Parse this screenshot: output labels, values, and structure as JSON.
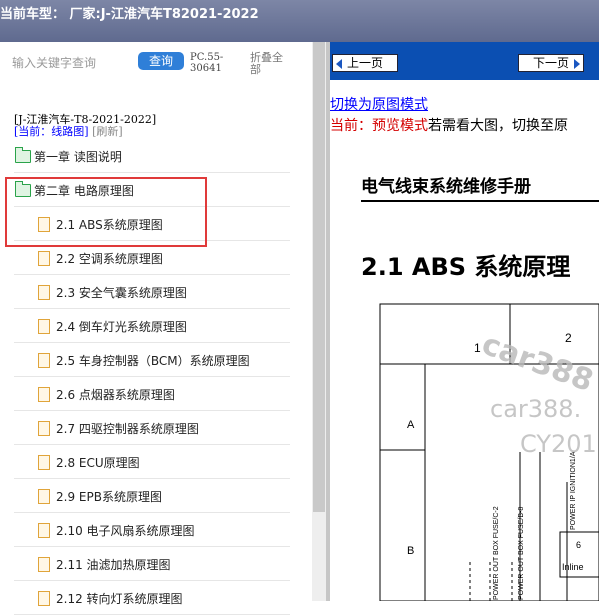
{
  "window": {
    "title": "当前车型： 厂家:J-江淮汽车T82021-2022"
  },
  "search": {
    "placeholder": "输入关键字查询",
    "button": "查询",
    "code": "PC.55-30641",
    "collapse": "折叠全部"
  },
  "tree": {
    "header_model": "[J-江淮汽车-T8-2021-2022]",
    "current_label": "[当前：",
    "current_value": "线路图]",
    "refresh": "[刷新]",
    "items": [
      {
        "label": "第一章 读图说明",
        "icon": "folder-icon"
      },
      {
        "label": "第二章 电路原理图",
        "icon": "folder-open-icon"
      },
      {
        "label": "2.1 ABS系统原理图",
        "icon": "file-icon"
      },
      {
        "label": "2.2 空调系统原理图",
        "icon": "file-icon"
      },
      {
        "label": "2.3 安全气囊系统原理图",
        "icon": "file-icon"
      },
      {
        "label": "2.4 倒车灯光系统原理图",
        "icon": "file-icon"
      },
      {
        "label": "2.5 车身控制器（BCM）系统原理图",
        "icon": "file-icon"
      },
      {
        "label": "2.6 点烟器系统原理图",
        "icon": "file-icon"
      },
      {
        "label": "2.7 四驱控制器系统原理图",
        "icon": "file-icon"
      },
      {
        "label": "2.8 ECU原理图",
        "icon": "file-icon"
      },
      {
        "label": "2.9 EPB系统原理图",
        "icon": "file-icon"
      },
      {
        "label": "2.10 电子风扇系统原理图",
        "icon": "file-icon"
      },
      {
        "label": "2.11 油滤加热原理图",
        "icon": "file-icon"
      },
      {
        "label": "2.12 转向灯系统原理图",
        "icon": "file-icon"
      }
    ]
  },
  "viewer": {
    "prev_page": "上一页",
    "next_page": "下一页",
    "switch_link": "切换为原图模式",
    "mode_label": "当前：预览模式",
    "mode_hint": "若需看大图，切换至原",
    "doc_title": "电气线束系统维修手册",
    "section_title": "2.1 ABS 系统原理",
    "schematic": {
      "row_labels": [
        "A",
        "B"
      ],
      "col_labels": [
        "1",
        "2"
      ],
      "wire_labels": [
        "POWER OUT BOX FUSE/C-2",
        "POWER OUT BOX FUSE/B-8",
        "POWER IP IGNITION1/A"
      ],
      "connector_label": "Inline",
      "pin_label": "6",
      "watermarks": [
        "car388",
        "car388.",
        "CY201"
      ]
    }
  },
  "colors": {
    "titlebar": "#6f7899",
    "query": "#2f7fd8",
    "navbar": "#0b4fb2",
    "highlight": "#e03a3a",
    "link": "#0000ff",
    "mode": "#d40000"
  }
}
